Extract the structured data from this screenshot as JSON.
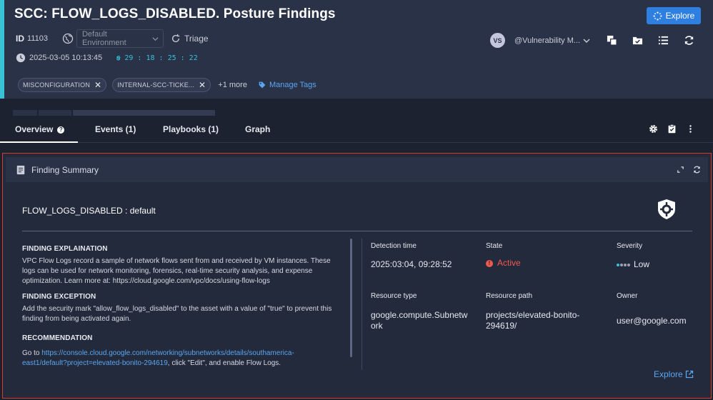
{
  "header": {
    "title": "SCC: FLOW_LOGS_DISABLED. Posture Findings",
    "explore_label": "Explore",
    "id_label": "ID",
    "id_value": "11103",
    "environment": "Default Environment",
    "triage_label": "Triage",
    "created_time": "2025-03-05 10:13:45",
    "timer_value": "29 : 18 : 25 : 22",
    "user_initials": "VS",
    "user_name": "@Vulnerability M...",
    "tags": [
      "MISCONFIGURATION",
      "INTERNAL-SCC-TICKE..."
    ],
    "more_tags": "+1 more",
    "manage_tags_label": "Manage Tags"
  },
  "tabs": {
    "overview": "Overview",
    "events": "Events (1)",
    "playbooks": "Playbooks (1)",
    "graph": "Graph"
  },
  "panel": {
    "title": "Finding Summary",
    "finding_name": "FLOW_LOGS_DISABLED : default",
    "explanation_title": "FINDING EXPLAINATION",
    "explanation_text": "VPC Flow Logs record a sample of network flows sent from and received by VM instances. These logs can be used for network monitoring, forensics, real-time security analysis, and expense optimization. Learn more at: https://cloud.google.com/vpc/docs/using-flow-logs",
    "exception_title": "FINDING EXCEPTION",
    "exception_text": "Add the security mark \"allow_flow_logs_disabled\" to the asset with a value of \"true\" to prevent this finding from being activated again.",
    "recommendation_title": "RECOMMENDATION",
    "recommendation_prefix": "Go to ",
    "recommendation_link": "https://console.cloud.google.com/networking/subnetworks/details/southamerica-east1/default?project=elevated-bonito-294619",
    "recommendation_suffix": ", click \"Edit\", and enable Flow Logs.",
    "detection_time_label": "Detection time",
    "detection_time": "2025:03:04, 09:28:52",
    "state_label": "State",
    "state": "Active",
    "severity_label": "Severity",
    "severity": "Low",
    "severity_level": 1,
    "resource_type_label": "Resource type",
    "resource_type": "google.compute.Subnetwork",
    "resource_path_label": "Resource path",
    "resource_path": "projects/elevated-bonito-294619/",
    "owner_label": "Owner",
    "owner": "user@google.com",
    "explore_link": "Explore"
  },
  "colors": {
    "accent": "#39c1d8",
    "primary_button": "#2f7fe0",
    "link": "#5aa5f0",
    "active_state": "#ef5a4f",
    "panel_border": "#d83a2a"
  }
}
